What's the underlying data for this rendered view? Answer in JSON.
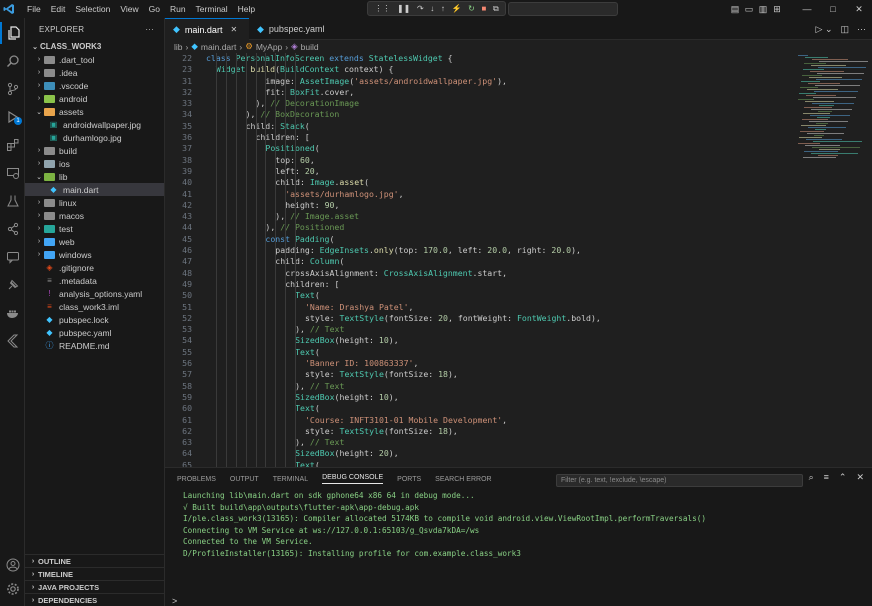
{
  "titlebar": {
    "menus": [
      "File",
      "Edit",
      "Selection",
      "View",
      "Go",
      "Run",
      "Terminal",
      "Help"
    ]
  },
  "explorer": {
    "title": "EXPLORER",
    "more": "···",
    "project": "CLASS_WORK3",
    "items": [
      {
        "label": ".dart_tool",
        "type": "folder",
        "depth": 1,
        "expanded": false,
        "color": "#8b8b8b"
      },
      {
        "label": ".idea",
        "type": "folder",
        "depth": 1,
        "expanded": false,
        "color": "#8b8b8b"
      },
      {
        "label": ".vscode",
        "type": "folder",
        "depth": 1,
        "expanded": false,
        "color": "#3d8eb9"
      },
      {
        "label": "android",
        "type": "folder",
        "depth": 1,
        "expanded": false,
        "color": "#8bc34a"
      },
      {
        "label": "assets",
        "type": "folder",
        "depth": 1,
        "expanded": true,
        "color": "#e8a44c"
      },
      {
        "label": "androidwallpaper.jpg",
        "type": "image",
        "depth": 2,
        "color": "#26a69a"
      },
      {
        "label": "durhamlogo.jpg",
        "type": "image",
        "depth": 2,
        "color": "#26a69a"
      },
      {
        "label": "build",
        "type": "folder",
        "depth": 1,
        "expanded": false,
        "color": "#8b8b8b"
      },
      {
        "label": "ios",
        "type": "folder",
        "depth": 1,
        "expanded": false,
        "color": "#90a4ae"
      },
      {
        "label": "lib",
        "type": "folder",
        "depth": 1,
        "expanded": true,
        "color": "#7cb342"
      },
      {
        "label": "main.dart",
        "type": "dart",
        "depth": 2,
        "color": "#40c4ff",
        "selected": true
      },
      {
        "label": "linux",
        "type": "folder",
        "depth": 1,
        "expanded": false,
        "color": "#8b8b8b"
      },
      {
        "label": "macos",
        "type": "folder",
        "depth": 1,
        "expanded": false,
        "color": "#8b8b8b"
      },
      {
        "label": "test",
        "type": "folder",
        "depth": 1,
        "expanded": false,
        "color": "#26a69a"
      },
      {
        "label": "web",
        "type": "folder",
        "depth": 1,
        "expanded": false,
        "color": "#42a5f5"
      },
      {
        "label": "windows",
        "type": "folder",
        "depth": 1,
        "expanded": false,
        "color": "#42a5f5"
      },
      {
        "label": ".gitignore",
        "type": "git",
        "depth": 1,
        "color": "#e64a19"
      },
      {
        "label": ".metadata",
        "type": "file",
        "depth": 1,
        "color": "#8b8b8b"
      },
      {
        "label": "analysis_options.yaml",
        "type": "yaml",
        "depth": 1,
        "color": "#ab47bc"
      },
      {
        "label": "class_work3.iml",
        "type": "file",
        "depth": 1,
        "color": "#e64a19"
      },
      {
        "label": "pubspec.lock",
        "type": "dart",
        "depth": 1,
        "color": "#40c4ff"
      },
      {
        "label": "pubspec.yaml",
        "type": "dart",
        "depth": 1,
        "color": "#40c4ff"
      },
      {
        "label": "README.md",
        "type": "info",
        "depth": 1,
        "color": "#42a5f5"
      }
    ],
    "sections": [
      "OUTLINE",
      "TIMELINE",
      "JAVA PROJECTS",
      "DEPENDENCIES"
    ]
  },
  "editor": {
    "tabs": [
      {
        "label": "main.dart",
        "active": true
      },
      {
        "label": "pubspec.yaml",
        "active": false
      }
    ],
    "breadcrumbs": [
      "lib",
      "main.dart",
      "MyApp",
      "build"
    ],
    "lines": [
      {
        "n": "22",
        "i": 0,
        "t": [
          [
            "class ",
            "kw"
          ],
          [
            "PersonalInfoScreen ",
            "cls"
          ],
          [
            "extends ",
            "kw"
          ],
          [
            "StatelessWidget ",
            "cls"
          ],
          [
            "{",
            ""
          ]
        ]
      },
      {
        "n": "23",
        "i": 1,
        "t": [
          [
            "Widget ",
            "cls"
          ],
          [
            "build",
            "fn"
          ],
          [
            "(",
            ""
          ],
          [
            "BuildContext ",
            "cls"
          ],
          [
            "context) {",
            ""
          ]
        ]
      },
      {
        "n": "31",
        "i": 6,
        "t": [
          [
            "image",
            ""
          ],
          [
            ": ",
            ""
          ],
          [
            "AssetImage",
            "cls"
          ],
          [
            "(",
            ""
          ],
          [
            "'assets/androidwallpaper.jpg'",
            "str"
          ],
          [
            "),",
            ""
          ]
        ]
      },
      {
        "n": "32",
        "i": 6,
        "t": [
          [
            "fit",
            ""
          ],
          [
            ": ",
            ""
          ],
          [
            "BoxFit",
            "cls"
          ],
          [
            ".cover,",
            ""
          ]
        ]
      },
      {
        "n": "33",
        "i": 5,
        "t": [
          [
            "), ",
            ""
          ],
          [
            "// DecorationImage",
            "cm"
          ]
        ]
      },
      {
        "n": "34",
        "i": 4,
        "t": [
          [
            "), ",
            ""
          ],
          [
            "// BoxDecoration",
            "cm"
          ]
        ]
      },
      {
        "n": "35",
        "i": 4,
        "t": [
          [
            "child",
            ""
          ],
          [
            ": ",
            ""
          ],
          [
            "Stack",
            "cls"
          ],
          [
            "(",
            ""
          ]
        ]
      },
      {
        "n": "36",
        "i": 5,
        "t": [
          [
            "children",
            ""
          ],
          [
            ": [",
            ""
          ]
        ]
      },
      {
        "n": "37",
        "i": 6,
        "t": [
          [
            "Positioned",
            "cls"
          ],
          [
            "(",
            ""
          ]
        ]
      },
      {
        "n": "38",
        "i": 7,
        "t": [
          [
            "top",
            ""
          ],
          [
            ": ",
            ""
          ],
          [
            "60",
            "num"
          ],
          [
            ",",
            ""
          ]
        ]
      },
      {
        "n": "39",
        "i": 7,
        "t": [
          [
            "left",
            ""
          ],
          [
            ": ",
            ""
          ],
          [
            "20",
            "num"
          ],
          [
            ",",
            ""
          ]
        ]
      },
      {
        "n": "40",
        "i": 7,
        "t": [
          [
            "child",
            ""
          ],
          [
            ": ",
            ""
          ],
          [
            "Image",
            "cls"
          ],
          [
            ".",
            ""
          ],
          [
            "asset",
            "fn"
          ],
          [
            "(",
            ""
          ]
        ]
      },
      {
        "n": "41",
        "i": 8,
        "t": [
          [
            "'assets/durhamlogo.jpg'",
            "str"
          ],
          [
            ",",
            ""
          ]
        ]
      },
      {
        "n": "42",
        "i": 8,
        "t": [
          [
            "height",
            ""
          ],
          [
            ": ",
            ""
          ],
          [
            "90",
            "num"
          ],
          [
            ",",
            ""
          ]
        ]
      },
      {
        "n": "43",
        "i": 7,
        "t": [
          [
            "), ",
            ""
          ],
          [
            "// Image.asset",
            "cm"
          ]
        ]
      },
      {
        "n": "44",
        "i": 6,
        "t": [
          [
            "), ",
            ""
          ],
          [
            "// Positioned",
            "cm"
          ]
        ]
      },
      {
        "n": "45",
        "i": 6,
        "t": [
          [
            "const ",
            "kw"
          ],
          [
            "Padding",
            "cls"
          ],
          [
            "(",
            ""
          ]
        ]
      },
      {
        "n": "46",
        "i": 7,
        "t": [
          [
            "padding",
            ""
          ],
          [
            ": ",
            ""
          ],
          [
            "EdgeInsets",
            "cls"
          ],
          [
            ".",
            ""
          ],
          [
            "only",
            "fn"
          ],
          [
            "(top: ",
            ""
          ],
          [
            "170.0",
            "num"
          ],
          [
            ", left: ",
            ""
          ],
          [
            "20.0",
            "num"
          ],
          [
            ", right: ",
            ""
          ],
          [
            "20.0",
            "num"
          ],
          [
            "),",
            ""
          ]
        ]
      },
      {
        "n": "47",
        "i": 7,
        "t": [
          [
            "child",
            ""
          ],
          [
            ": ",
            ""
          ],
          [
            "Column",
            "cls"
          ],
          [
            "(",
            ""
          ]
        ]
      },
      {
        "n": "48",
        "i": 8,
        "t": [
          [
            "crossAxisAlignment",
            ""
          ],
          [
            ": ",
            ""
          ],
          [
            "CrossAxisAlignment",
            "cls"
          ],
          [
            ".start,",
            ""
          ]
        ]
      },
      {
        "n": "49",
        "i": 8,
        "t": [
          [
            "children",
            ""
          ],
          [
            ": [",
            ""
          ]
        ]
      },
      {
        "n": "50",
        "i": 9,
        "t": [
          [
            "Text",
            "cls"
          ],
          [
            "(",
            ""
          ]
        ]
      },
      {
        "n": "51",
        "i": 10,
        "t": [
          [
            "'Name: Drashya Patel'",
            "str"
          ],
          [
            ",",
            ""
          ]
        ]
      },
      {
        "n": "52",
        "i": 10,
        "t": [
          [
            "style",
            ""
          ],
          [
            ": ",
            ""
          ],
          [
            "TextStyle",
            "cls"
          ],
          [
            "(fontSize: ",
            ""
          ],
          [
            "20",
            "num"
          ],
          [
            ", fontWeight: ",
            ""
          ],
          [
            "FontWeight",
            "cls"
          ],
          [
            ".bold),",
            ""
          ]
        ]
      },
      {
        "n": "53",
        "i": 9,
        "t": [
          [
            "), ",
            ""
          ],
          [
            "// Text",
            "cm"
          ]
        ]
      },
      {
        "n": "54",
        "i": 9,
        "t": [
          [
            "SizedBox",
            "cls"
          ],
          [
            "(height: ",
            ""
          ],
          [
            "10",
            "num"
          ],
          [
            "),",
            ""
          ]
        ]
      },
      {
        "n": "55",
        "i": 9,
        "t": [
          [
            "Text",
            "cls"
          ],
          [
            "(",
            ""
          ]
        ]
      },
      {
        "n": "56",
        "i": 10,
        "t": [
          [
            "'Banner ID: 100863337'",
            "str"
          ],
          [
            ",",
            ""
          ]
        ]
      },
      {
        "n": "57",
        "i": 10,
        "t": [
          [
            "style",
            ""
          ],
          [
            ": ",
            ""
          ],
          [
            "TextStyle",
            "cls"
          ],
          [
            "(fontSize: ",
            ""
          ],
          [
            "18",
            "num"
          ],
          [
            "),",
            ""
          ]
        ]
      },
      {
        "n": "58",
        "i": 9,
        "t": [
          [
            "), ",
            ""
          ],
          [
            "// Text",
            "cm"
          ]
        ]
      },
      {
        "n": "59",
        "i": 9,
        "t": [
          [
            "SizedBox",
            "cls"
          ],
          [
            "(height: ",
            ""
          ],
          [
            "10",
            "num"
          ],
          [
            "),",
            ""
          ]
        ]
      },
      {
        "n": "60",
        "i": 9,
        "t": [
          [
            "Text",
            "cls"
          ],
          [
            "(",
            ""
          ]
        ]
      },
      {
        "n": "61",
        "i": 10,
        "t": [
          [
            "'Course: INFT3101-01 Mobile Development'",
            "str"
          ],
          [
            ",",
            ""
          ]
        ]
      },
      {
        "n": "62",
        "i": 10,
        "t": [
          [
            "style",
            ""
          ],
          [
            ": ",
            ""
          ],
          [
            "TextStyle",
            "cls"
          ],
          [
            "(fontSize: ",
            ""
          ],
          [
            "18",
            "num"
          ],
          [
            "),",
            ""
          ]
        ]
      },
      {
        "n": "63",
        "i": 9,
        "t": [
          [
            "), ",
            ""
          ],
          [
            "// Text",
            "cm"
          ]
        ]
      },
      {
        "n": "64",
        "i": 9,
        "t": [
          [
            "SizedBox",
            "cls"
          ],
          [
            "(height: ",
            ""
          ],
          [
            "20",
            "num"
          ],
          [
            "),",
            ""
          ]
        ]
      },
      {
        "n": "65",
        "i": 9,
        "t": [
          [
            "Text",
            "cls"
          ],
          [
            "(",
            ""
          ]
        ]
      }
    ]
  },
  "panel": {
    "tabs": [
      "PROBLEMS",
      "OUTPUT",
      "TERMINAL",
      "DEBUG CONSOLE",
      "PORTS",
      "SEARCH ERROR"
    ],
    "active_tab": "DEBUG CONSOLE",
    "filter_placeholder": "Filter (e.g. text, !exclude, \\escape)",
    "console_lines": [
      "Launching lib\\main.dart on sdk gphone64 x86 64 in debug mode...",
      "√ Built build\\app\\outputs\\flutter-apk\\app-debug.apk",
      "I/ple.class_work3(13165): Compiler allocated 5174KB to compile void android.view.ViewRootImpl.performTraversals()",
      "Connecting to VM Service at ws://127.0.0.1:65103/g_Qsvda7kDA=/ws",
      "Connected to the VM Service.",
      "D/ProfileInstaller(13165): Installing profile for com.example.class_work3"
    ],
    "prompt": ">"
  },
  "colors": {
    "accent": "#0078d4",
    "console_text": "#89d185"
  }
}
